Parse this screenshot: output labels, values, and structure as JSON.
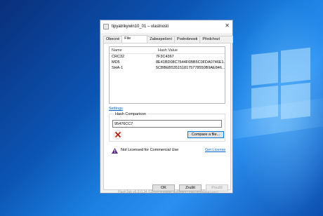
{
  "window": {
    "title": "tipyatrikywin10_01 – vlastnosti"
  },
  "tabs": [
    {
      "label": "Obecné"
    },
    {
      "label": "File Hashes"
    },
    {
      "label": "Zabezpečení"
    },
    {
      "label": "Podrobnosti"
    },
    {
      "label": "Předchozí verze"
    }
  ],
  "hash_list": {
    "headers": {
      "name": "Name",
      "value": "Hash Value"
    },
    "rows": [
      {
        "name": "CRC32",
        "value": "7F3C4367"
      },
      {
        "name": "MD5",
        "value": "8E41BD08C7644F6BB5C0FDA0746E1..."
      },
      {
        "name": "SHA-1",
        "value": "5CBBEB5351518175778550B9AE846..."
      }
    ]
  },
  "settings_link": "Settings",
  "hash_comparison": {
    "label": "Hash Comparison",
    "value": "95476CC7",
    "compare_button": "Compare a file..."
  },
  "license": {
    "text": "Not Licensed for Commercial Use",
    "link": "Get License"
  },
  "footer": "HashTab v6.0.0.34 ©2016 Implbits Software (http://implbits.com)",
  "buttons": {
    "ok": "OK",
    "cancel": "Zrušit",
    "apply": "Použít"
  },
  "colors": {
    "link": "#0066cc",
    "accent": "#0078d7",
    "error_icon": "#c0392b",
    "warning_icon": "#5b2a86"
  }
}
